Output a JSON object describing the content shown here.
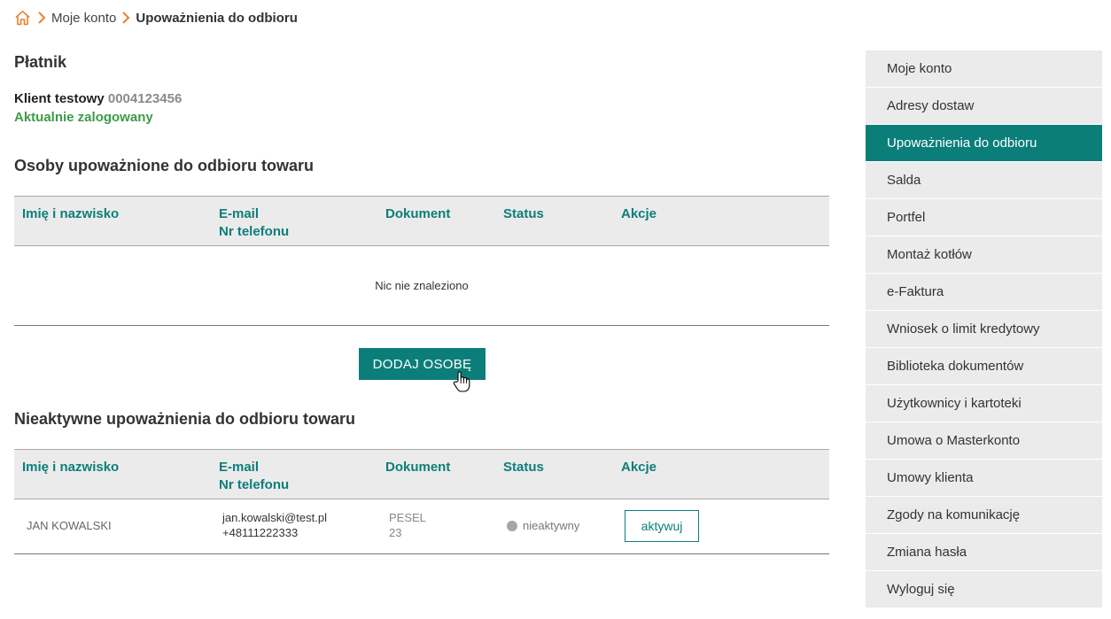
{
  "breadcrumb": {
    "items": [
      "Moje konto",
      "Upoważnienia do odbioru"
    ]
  },
  "payer": {
    "title": "Płatnik",
    "client_name": "Klient testowy",
    "client_number": "0004123456",
    "status": "Aktualnie zalogowany"
  },
  "active_section": {
    "title": "Osoby upoważnione do odbioru towaru",
    "headers": {
      "name": "Imię i nazwisko",
      "email": "E-mail",
      "phone": "Nr telefonu",
      "document": "Dokument",
      "status": "Status",
      "actions": "Akcje"
    },
    "empty_text": "Nic nie znaleziono",
    "add_button": "DODAJ OSOBĘ"
  },
  "inactive_section": {
    "title": "Nieaktywne upoważnienia do odbioru towaru",
    "headers": {
      "name": "Imię i nazwisko",
      "email": "E-mail",
      "phone": "Nr telefonu",
      "document": "Dokument",
      "status": "Status",
      "actions": "Akcje"
    },
    "rows": [
      {
        "name": "JAN KOWALSKI",
        "email": "jan.kowalski@test.pl",
        "phone": "+48111222333",
        "doc_type": "PESEL",
        "doc_number": "23",
        "status": "nieaktywny",
        "action": "aktywuj"
      }
    ]
  },
  "sidebar": {
    "items": [
      {
        "label": "Moje konto"
      },
      {
        "label": "Adresy dostaw"
      },
      {
        "label": "Upoważnienia do odbioru"
      },
      {
        "label": "Salda"
      },
      {
        "label": "Portfel"
      },
      {
        "label": "Montaż kotłów"
      },
      {
        "label": "e-Faktura"
      },
      {
        "label": "Wniosek o limit kredytowy"
      },
      {
        "label": "Biblioteka dokumentów"
      },
      {
        "label": "Użytkownicy i kartoteki"
      },
      {
        "label": "Umowa o Masterkonto"
      },
      {
        "label": "Umowy klienta"
      },
      {
        "label": "Zgody na komunikację"
      },
      {
        "label": "Zmiana hasła"
      },
      {
        "label": "Wyloguj się"
      }
    ],
    "active_index": 2
  },
  "colors": {
    "accent": "#0c7e7a",
    "breadcrumb_icon": "#e8802f",
    "logged_in": "#3e9a4a",
    "sidebar_bg": "#ebebeb"
  },
  "icons": {
    "home": "home-icon",
    "chevron": "chevron-right-icon",
    "cursor": "hand-pointer-icon",
    "status": "status-dot-icon"
  }
}
